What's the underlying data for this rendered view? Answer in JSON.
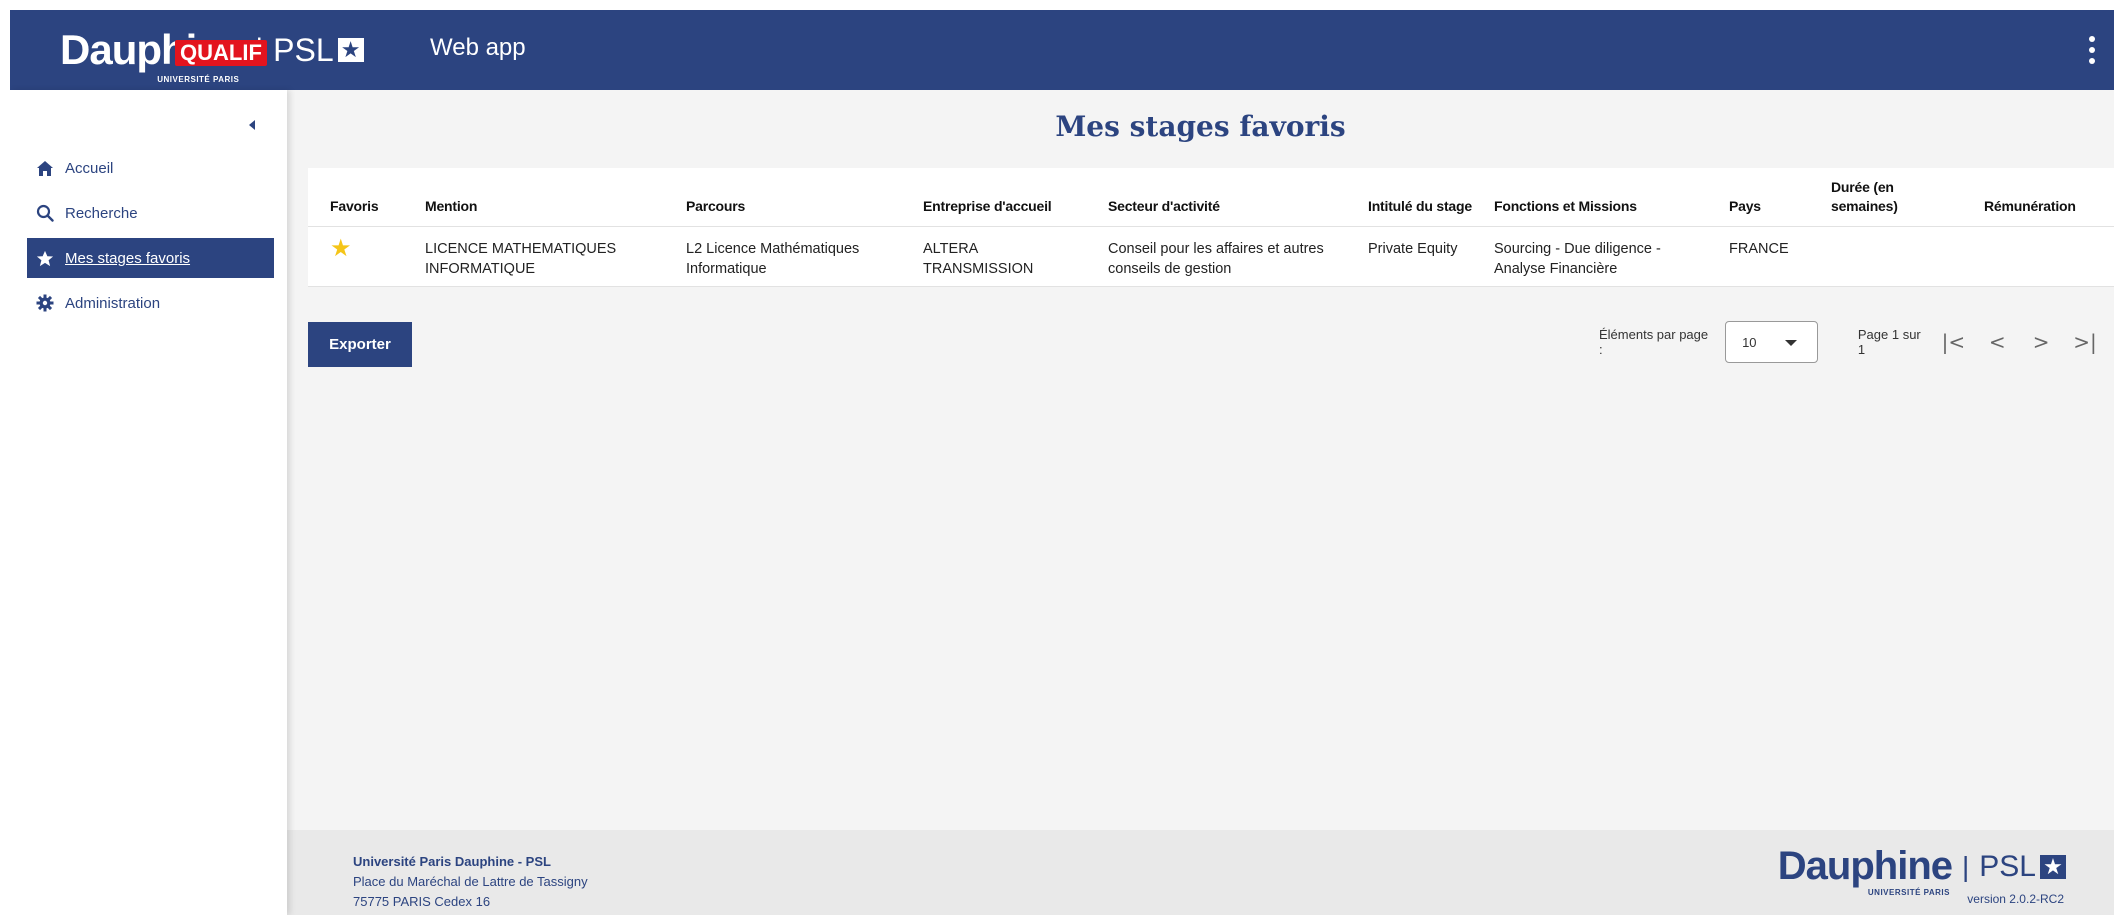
{
  "header": {
    "logo_text": "Dauphine",
    "logo_sub": "UNIVERSITÉ PARIS",
    "env_badge": "QUALIF",
    "psl_text": "PSL",
    "app_name": "Web app",
    "brand_color": "#2c4480"
  },
  "sidebar": {
    "items": [
      {
        "label": "Accueil",
        "icon": "home-icon",
        "active": false
      },
      {
        "label": "Recherche",
        "icon": "search-icon",
        "active": false
      },
      {
        "label": "Mes stages favoris",
        "icon": "star-icon",
        "active": true
      },
      {
        "label": "Administration",
        "icon": "gear-icon",
        "active": false
      }
    ]
  },
  "main": {
    "title": "Mes stages favoris",
    "table": {
      "headers": [
        "Favoris",
        "Mention",
        "Parcours",
        "Entreprise d'accueil",
        "Secteur d'activité",
        "Intitulé du stage",
        "Fonctions et Missions",
        "Pays",
        "Durée (en semaines)",
        "Rémunération"
      ],
      "rows": [
        {
          "favori": "★",
          "mention": "LICENCE MATHEMATIQUES INFORMATIQUE",
          "parcours": "L2 Licence Mathématiques Informatique",
          "entreprise": "ALTERA TRANSMISSION",
          "secteur": "Conseil pour les affaires et autres conseils de gestion",
          "intitule": "Private Equity",
          "fonctions": "Sourcing - Due diligence - Analyse Financière",
          "pays": "FRANCE",
          "duree": "",
          "remuneration": ""
        }
      ]
    },
    "export_label": "Exporter",
    "paginator": {
      "per_page_label": "Éléments par page :",
      "per_page_value": "10",
      "range_label": "Page 1 sur 1",
      "first": "|<",
      "prev": "<",
      "next": ">",
      "last": ">|"
    }
  },
  "footer": {
    "org_name": "Université Paris Dauphine - PSL",
    "address_line1": "Place du Maréchal de Lattre de Tassigny",
    "address_line2": "75775 PARIS Cedex 16",
    "logo_text": "Dauphine",
    "logo_sub": "UNIVERSITÉ PARIS",
    "psl_text": "PSL",
    "version": "version 2.0.2-RC2"
  }
}
